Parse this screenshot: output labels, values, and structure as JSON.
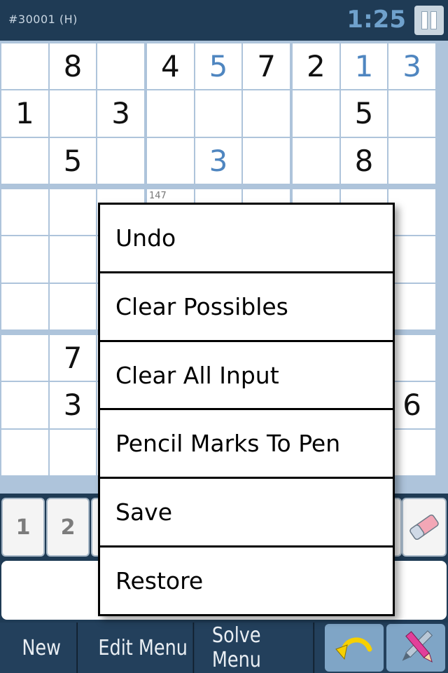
{
  "status_bar": {
    "puzzle_id": "#30001 (H)",
    "timer": "1:25"
  },
  "grid": {
    "rows": [
      [
        {
          "v": ""
        },
        {
          "v": "8"
        },
        {
          "v": ""
        },
        {
          "v": "4"
        },
        {
          "v": "5",
          "user": true
        },
        {
          "v": "7"
        },
        {
          "v": "2"
        },
        {
          "v": "1",
          "user": true
        },
        {
          "v": "3",
          "user": true
        }
      ],
      [
        {
          "v": "1"
        },
        {
          "v": ""
        },
        {
          "v": "3"
        },
        {
          "v": ""
        },
        {
          "v": ""
        },
        {
          "v": ""
        },
        {
          "v": ""
        },
        {
          "v": "5"
        },
        {
          "v": ""
        }
      ],
      [
        {
          "v": ""
        },
        {
          "v": "5"
        },
        {
          "v": ""
        },
        {
          "v": ""
        },
        {
          "v": "3",
          "user": true
        },
        {
          "v": ""
        },
        {
          "v": ""
        },
        {
          "v": "8"
        },
        {
          "v": ""
        }
      ],
      [
        {
          "v": ""
        },
        {
          "v": ""
        },
        {
          "v": ""
        },
        {
          "v": "",
          "pencil": "147"
        },
        {
          "v": ""
        },
        {
          "v": ""
        },
        {
          "v": ""
        },
        {
          "v": ""
        },
        {
          "v": ""
        }
      ],
      [
        {
          "v": ""
        },
        {
          "v": ""
        },
        {
          "v": ""
        },
        {
          "v": ""
        },
        {
          "v": ""
        },
        {
          "v": ""
        },
        {
          "v": ""
        },
        {
          "v": ""
        },
        {
          "v": ""
        }
      ],
      [
        {
          "v": ""
        },
        {
          "v": ""
        },
        {
          "v": ""
        },
        {
          "v": ""
        },
        {
          "v": ""
        },
        {
          "v": ""
        },
        {
          "v": ""
        },
        {
          "v": ""
        },
        {
          "v": ""
        }
      ],
      [
        {
          "v": ""
        },
        {
          "v": "7"
        },
        {
          "v": ""
        },
        {
          "v": ""
        },
        {
          "v": ""
        },
        {
          "v": ""
        },
        {
          "v": ""
        },
        {
          "v": ""
        },
        {
          "v": ""
        }
      ],
      [
        {
          "v": ""
        },
        {
          "v": "3"
        },
        {
          "v": ""
        },
        {
          "v": ""
        },
        {
          "v": ""
        },
        {
          "v": ""
        },
        {
          "v": ""
        },
        {
          "v": ""
        },
        {
          "v": "6"
        }
      ],
      [
        {
          "v": ""
        },
        {
          "v": ""
        },
        {
          "v": ""
        },
        {
          "v": ""
        },
        {
          "v": ""
        },
        {
          "v": ""
        },
        {
          "v": ""
        },
        {
          "v": ""
        },
        {
          "v": ""
        }
      ]
    ]
  },
  "number_pad": {
    "keys": [
      "1",
      "2"
    ],
    "eraser_icon": "eraser-icon"
  },
  "toolbar": {
    "new_label": "New",
    "edit_menu_label": "Edit Menu",
    "solve_menu_label": "Solve Menu",
    "undo_icon": "undo-arrow-icon",
    "pencil_icon": "pencil-pen-icon"
  },
  "edit_menu": {
    "items": [
      "Undo",
      "Clear Possibles",
      "Clear All Input",
      "Pencil Marks To Pen",
      "Save",
      "Restore"
    ]
  },
  "colors": {
    "header_bg": "#1f3b55",
    "grid_line": "#aec4db",
    "user_digit": "#4f86c0",
    "timer": "#6fa1cc"
  }
}
